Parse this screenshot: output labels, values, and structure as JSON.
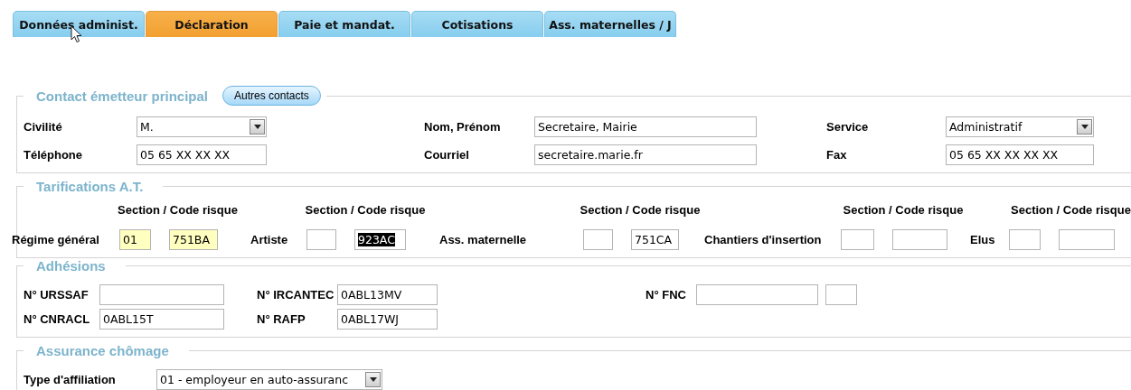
{
  "tabs": [
    {
      "label": "Données administ.",
      "selected": false
    },
    {
      "label": "Déclaration",
      "selected": true
    },
    {
      "label": "Paie et mandat.",
      "selected": false
    },
    {
      "label": "Cotisations",
      "selected": false
    },
    {
      "label": "Ass. maternelles / J",
      "selected": false
    }
  ],
  "sections": [
    {
      "kind": "contact",
      "title": "Contact émetteur principal",
      "button": "Autres contacts",
      "rows": [
        {
          "items": [
            {
              "label": "Civilité",
              "fields": [
                {
                  "kind": "select",
                  "value": "M."
                }
              ]
            },
            {
              "label": "Nom, Prénom",
              "fields": [
                {
                  "kind": "text",
                  "value": "Secretaire, Mairie"
                }
              ]
            },
            {
              "label": "Service",
              "fields": [
                {
                  "kind": "select",
                  "value": "Administratif"
                }
              ]
            }
          ]
        },
        {
          "items": [
            {
              "label": "Téléphone",
              "fields": [
                {
                  "kind": "text",
                  "value": "05 65 XX XX XX"
                }
              ]
            },
            {
              "label": "Courriel",
              "fields": [
                {
                  "kind": "text",
                  "value": "secretaire.marie.fr"
                }
              ]
            },
            {
              "label": "Fax",
              "fields": [
                {
                  "kind": "text",
                  "value": "05 65 XX XX XX XX"
                }
              ]
            }
          ]
        }
      ]
    },
    {
      "kind": "tarif",
      "title": "Tarifications A.T.",
      "headers": [
        "Section / Code risque",
        "Section / Code risque",
        "Section / Code risque",
        "Section / Code risque",
        "Section / Code risque"
      ],
      "rows": [
        {
          "items": [
            {
              "label": "Régime général",
              "fields": [
                {
                  "kind": "text",
                  "value": "01",
                  "highlighted": true,
                  "text_selected": false
                },
                {
                  "kind": "text",
                  "value": "751BA",
                  "highlighted": true,
                  "text_selected": false
                }
              ]
            },
            {
              "label": "Artiste",
              "fields": [
                {
                  "kind": "text",
                  "highlighted": false
                },
                {
                  "kind": "text",
                  "value": "923AC",
                  "highlighted": false,
                  "text_selected": true
                }
              ]
            },
            {
              "label": "Ass. maternelle",
              "fields": [
                {
                  "kind": "text",
                  "highlighted": false
                },
                {
                  "kind": "text",
                  "value": "751CA",
                  "highlighted": false,
                  "text_selected": false
                }
              ]
            },
            {
              "label": "Chantiers d'insertion",
              "fields": [
                {
                  "kind": "text",
                  "highlighted": false
                },
                {
                  "kind": "text",
                  "highlighted": false
                }
              ]
            },
            {
              "label": "Elus",
              "fields": [
                {
                  "kind": "text",
                  "highlighted": false
                },
                {
                  "kind": "text",
                  "highlighted": false
                }
              ]
            }
          ]
        }
      ]
    },
    {
      "kind": "adhesion",
      "title": "Adhésions",
      "rows": [
        {
          "items": [
            {
              "label": "N° URSSAF",
              "fields": [
                {
                  "kind": "text"
                }
              ]
            },
            {
              "label": "N° IRCANTEC",
              "fields": [
                {
                  "kind": "text",
                  "value": "0ABL13MV"
                }
              ]
            },
            {
              "label": "N° FNC",
              "fields": [
                {
                  "kind": "text"
                },
                {
                  "kind": "text"
                }
              ]
            }
          ]
        },
        {
          "items": [
            {
              "label": "N° CNRACL",
              "fields": [
                {
                  "kind": "text",
                  "value": "0ABL15T"
                }
              ]
            },
            {
              "label": "N° RAFP",
              "fields": [
                {
                  "kind": "text",
                  "value": "0ABL17WJ"
                }
              ]
            }
          ]
        }
      ]
    },
    {
      "kind": "chomage",
      "title": "Assurance chômage",
      "rows": [
        {
          "items": [
            {
              "label": "Type d'affiliation",
              "fields": [
                {
                  "kind": "select",
                  "value": "01 - employeur en auto-assuranc"
                }
              ]
            }
          ]
        }
      ]
    }
  ]
}
